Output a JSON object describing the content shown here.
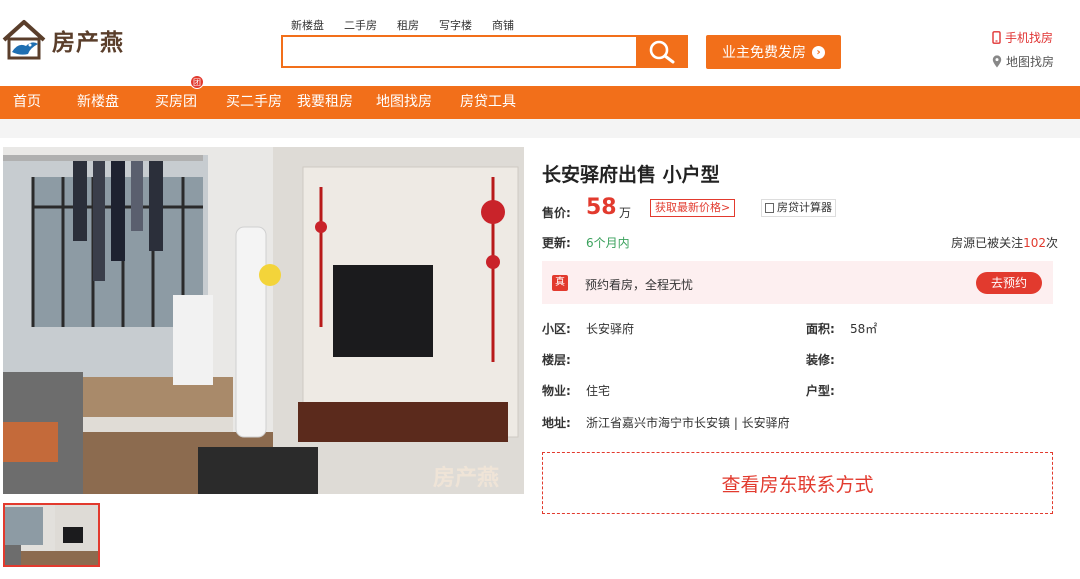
{
  "header": {
    "logo_text": "房产燕",
    "search_tabs": [
      "新楼盘",
      "二手房",
      "租房",
      "写字楼",
      "商铺"
    ],
    "search_placeholder": "",
    "post_button": "业主免费发房",
    "post_button_arrow": "›",
    "mobile_link": "手机找房",
    "map_link": "地图找房"
  },
  "nav": {
    "items": [
      "首页",
      "新楼盘",
      "买房团",
      "买二手房",
      "我要租房",
      "地图找房",
      "房贷工具"
    ],
    "badge": "团"
  },
  "listing": {
    "title": "长安驿府出售 小户型",
    "price_label": "售价:",
    "price_value": "58",
    "price_unit": "万",
    "get_price": "获取最新价格>",
    "calculator": "房贷计算器",
    "update_label": "更新:",
    "update_value": "6个月内",
    "follow_prefix": "房源已被关注",
    "follow_count": "102",
    "follow_suffix": "次",
    "appoint_badge": "真",
    "appoint_text": "预约看房，全程无忧",
    "appoint_button": "去预约",
    "details": {
      "community_label": "小区:",
      "community_value": "长安驿府",
      "area_label": "面积:",
      "area_value": "58㎡",
      "floor_label": "楼层:",
      "floor_value": "",
      "decoration_label": "装修:",
      "decoration_value": "",
      "property_label": "物业:",
      "property_value": "住宅",
      "layout_label": "户型:",
      "layout_value": "",
      "address_label": "地址:",
      "address_value": "浙江省嘉兴市海宁市长安镇 | 长安驿府"
    },
    "contact_button": "查看房东联系方式",
    "watermark": "房产燕"
  },
  "colors": {
    "brand_orange": "#f26f1a",
    "price_red": "#e23a2e",
    "update_green": "#3aa15c",
    "appoint_bg": "#fdeff0"
  }
}
